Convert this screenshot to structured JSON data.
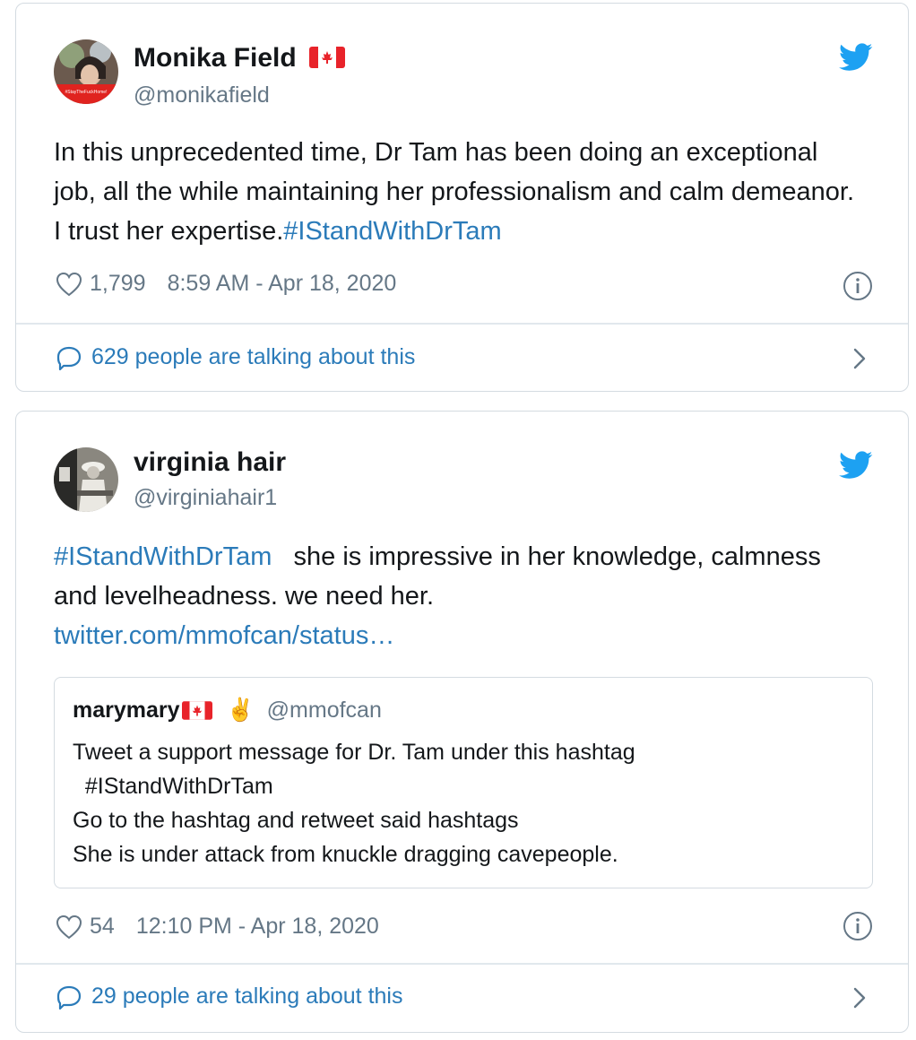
{
  "tweets": [
    {
      "name": "Monika Field",
      "name_flag": "canada-flag",
      "handle": "@monikafield",
      "avatar_text": "#StayTheFuckHome!",
      "body_text": "In this unprecedented time, Dr Tam has been doing an exceptional job, all the while maintaining her professionalism and calm demeanor. I trust her expertise.",
      "body_hashtag": "#IStandWithDrTam",
      "likes": "1,799",
      "timestamp": "8:59 AM - Apr 18, 2020",
      "talking": "629 people are talking about this"
    },
    {
      "name": "virginia hair",
      "handle": "@virginiahair1",
      "body_hashtag": "#IStandWithDrTam",
      "body_text": "   she is impressive in her knowledge, calmness and levelheadness. we need her.",
      "body_link": "twitter.com/mmofcan/status…",
      "quoted": {
        "name": "marymary",
        "name_flag": "canada-flag",
        "emoji": "✌️",
        "handle": "@mmofcan",
        "text": "Tweet a support message for Dr. Tam under this hashtag\n  #IStandWithDrTam\nGo to the hashtag and retweet said hashtags\nShe is under attack from knuckle dragging cavepeople."
      },
      "likes": "54",
      "timestamp": "12:10 PM - Apr 18, 2020",
      "talking": "29 people are talking about this"
    }
  ],
  "colors": {
    "link": "#2b7bb9",
    "twitter_blue": "#1da1f2",
    "secondary_text": "#657786",
    "border": "#d4dbe1"
  },
  "icons": [
    "twitter-bird-icon",
    "heart-icon",
    "info-icon",
    "reply-bubble-icon",
    "chevron-right-icon",
    "canada-flag"
  ]
}
